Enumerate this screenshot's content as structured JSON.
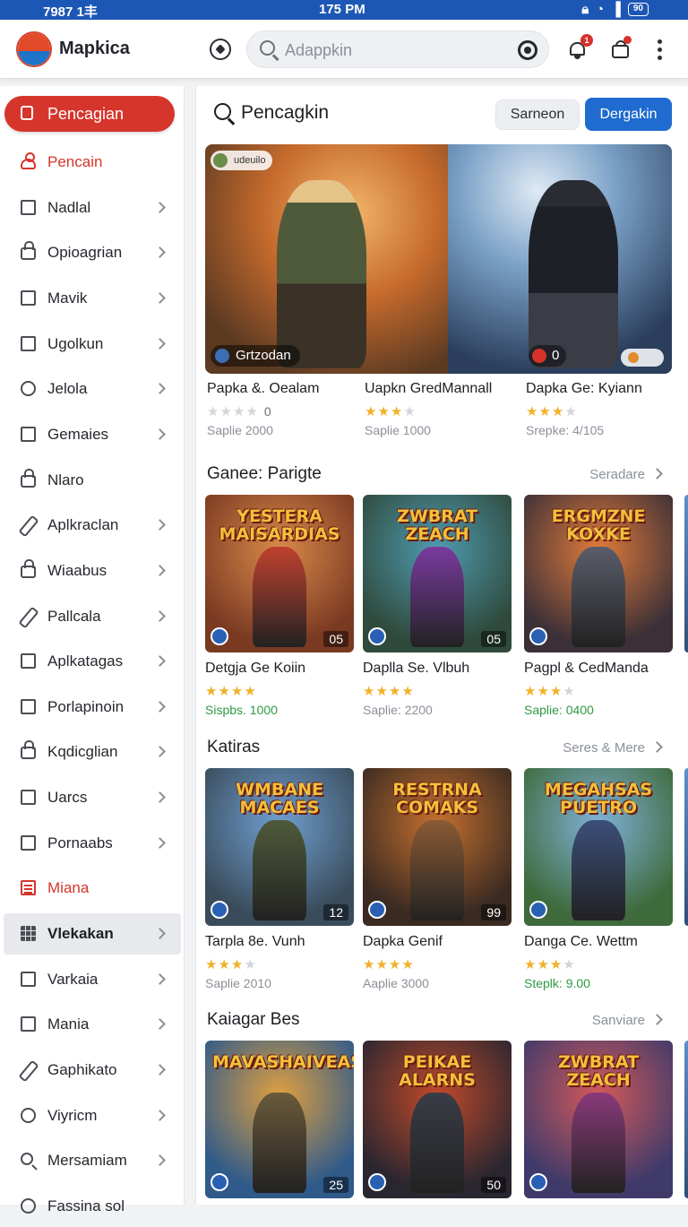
{
  "status_bar": {
    "left": "7987 1丰",
    "time": "175 PM",
    "battery": "90"
  },
  "app": {
    "title": "Mapkica",
    "notification_badge": "1"
  },
  "search": {
    "placeholder": "Adappkin"
  },
  "sidebar": {
    "primary": {
      "label": "Pencagian",
      "icon": "lock-icon"
    },
    "items": [
      {
        "label": "Pencain",
        "icon": "user-icon",
        "red": true,
        "chevron": false
      },
      {
        "label": "Nadlal",
        "icon": "square-icon",
        "chevron": true
      },
      {
        "label": "Opioagrian",
        "icon": "lock-icon",
        "chevron": true
      },
      {
        "label": "Mavik",
        "icon": "square-icon",
        "chevron": true
      },
      {
        "label": "Ugolkun",
        "icon": "list-icon",
        "chevron": true
      },
      {
        "label": "Jelola",
        "icon": "smile-icon",
        "chevron": true
      },
      {
        "label": "Gemaies",
        "icon": "square-icon",
        "chevron": true
      },
      {
        "label": "Nlaro",
        "icon": "lock-icon",
        "chevron": false
      },
      {
        "label": "Aplkraclan",
        "icon": "pen-icon",
        "chevron": true
      },
      {
        "label": "Wiaabus",
        "icon": "lock-icon",
        "chevron": true
      },
      {
        "label": "Pallcala",
        "icon": "pen-icon",
        "chevron": true
      },
      {
        "label": "Aplkatagas",
        "icon": "square-icon",
        "chevron": true
      },
      {
        "label": "Porlapinoin",
        "icon": "image-icon",
        "chevron": true
      },
      {
        "label": "Kqdicglian",
        "icon": "lock-icon",
        "chevron": true
      },
      {
        "label": "Uarcs",
        "icon": "list-icon",
        "chevron": true
      },
      {
        "label": "Pornaabs",
        "icon": "square-icon",
        "chevron": true
      },
      {
        "label": "Miana",
        "icon": "calendar-icon",
        "red": true,
        "chevron": false
      },
      {
        "label": "Vlekakan",
        "icon": "grid-icon",
        "active": true,
        "chevron": true
      },
      {
        "label": "Varkaia",
        "icon": "square-icon",
        "chevron": true
      },
      {
        "label": "Mania",
        "icon": "list-icon",
        "chevron": true
      },
      {
        "label": "Gaphikato",
        "icon": "pen-icon",
        "chevron": true
      },
      {
        "label": "Viyricm",
        "icon": "smile-icon",
        "chevron": true
      },
      {
        "label": "Mersamiam",
        "icon": "search-icon",
        "chevron": true
      },
      {
        "label": "Fassina sol",
        "icon": "smile-icon",
        "chevron": false
      }
    ]
  },
  "main": {
    "title": "Pencagkin",
    "secondary_button": "Sarneon",
    "primary_button": "Dergakin",
    "hero": {
      "chip": "udeuilo",
      "tag_left": "Grtzodan",
      "tag_right": "0",
      "captions": [
        {
          "name": "Papka &. Oealam",
          "rating": 0,
          "count": "0",
          "meta": "Saplie 2000",
          "green": false
        },
        {
          "name": "Uapkn GredMannall",
          "rating": 3,
          "count": "",
          "meta": "Saplie 1000",
          "green": false
        },
        {
          "name": "Dapka Ge: Kyiann",
          "rating": 3,
          "count": "",
          "meta": "Srepke: 4/105",
          "green": false
        }
      ]
    },
    "sections": [
      {
        "title": "Ganee: Parigte",
        "more": "Seradare",
        "cards": [
          {
            "art_title": "YESTERA MAISARDIAS",
            "num": "05",
            "name": "Detgja Ge Koiin",
            "rating": 4,
            "meta": "Sispbs. 1000",
            "green": true
          },
          {
            "art_title": "ZWBRAT ZEACH",
            "num": "05",
            "name": "Daplla Se. Vlbuh",
            "rating": 4,
            "meta": "Saplie: 2200",
            "green": false
          },
          {
            "art_title": "ERGMZNE KOXKE",
            "num": "",
            "name": "Pagpl & CedManda",
            "rating": 3,
            "meta": "Saplie: 0400",
            "green": true
          }
        ]
      },
      {
        "title": "Katiras",
        "more": "Seres & Mere",
        "cards": [
          {
            "art_title": "WMBANE MACAES",
            "num": "12",
            "name": "Tarpla 8e. Vunh",
            "rating": 3,
            "meta": "Saplie 2010",
            "green": false
          },
          {
            "art_title": "RESTRNA COMAKS",
            "num": "99",
            "name": "Dapka Genif",
            "rating": 4,
            "meta": "Aaplie 3000",
            "green": false
          },
          {
            "art_title": "MEGAHSAS PUETRO",
            "num": "",
            "name": "Danga Ce. Wettm",
            "rating": 3,
            "meta": "Steplk: 9.00",
            "green": true
          }
        ]
      },
      {
        "title": "Kaiagar Bes",
        "more": "Sanviare",
        "cards": [
          {
            "art_title": "MAVASHAIVEAS",
            "num": "25",
            "name": "",
            "rating": 0,
            "meta": "",
            "green": false
          },
          {
            "art_title": "PEIKAE ALARNS",
            "num": "50",
            "name": "",
            "rating": 0,
            "meta": "",
            "green": false
          },
          {
            "art_title": "ZWBRAT ZEACH",
            "num": "",
            "name": "",
            "rating": 0,
            "meta": "",
            "green": false
          }
        ]
      }
    ]
  },
  "colors": {
    "accent_red": "#d6352c",
    "accent_blue": "#1f6bd0",
    "status_bar": "#1d57b5",
    "star": "#f0b12a"
  }
}
